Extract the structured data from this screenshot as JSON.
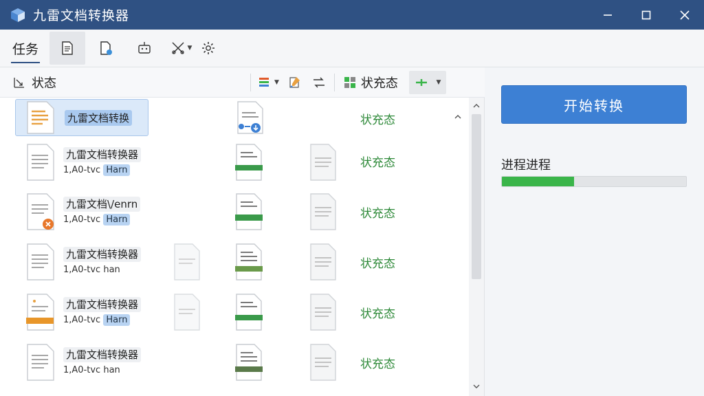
{
  "window": {
    "title": "九雷文档转换器",
    "controls": [
      "minimize-icon",
      "maximize-icon",
      "close-icon"
    ]
  },
  "toolbar": {
    "task_tab": "任务",
    "icons": [
      "document-icon",
      "file-settings-icon",
      "robot-icon",
      "tools-icon",
      "gear-icon"
    ]
  },
  "sub_toolbar": {
    "label": "状态",
    "status_label": "状充态"
  },
  "rows": [
    {
      "name": "九雷文档转换",
      "meta_prefix": "",
      "tag": "",
      "status": "状充态",
      "selected": true
    },
    {
      "name": "九雷文档转换器",
      "meta_prefix": "1,A0-tvc",
      "tag": "Harn",
      "status": "状充态",
      "selected": false
    },
    {
      "name": "九雷文档\\/enrn",
      "meta_prefix": "1,A0-tvc",
      "tag": "Harn",
      "status": "状充态",
      "selected": false
    },
    {
      "name": "九雷文档转换器",
      "meta_prefix": "1,A0-tvc han",
      "tag": "",
      "status": "状充态",
      "selected": false
    },
    {
      "name": "九雷文档转换器",
      "meta_prefix": "1,A0-tvc",
      "tag": "Harn",
      "status": "状充态",
      "selected": false
    },
    {
      "name": "九雷文档转换器",
      "meta_prefix": "1,A0-tvc han",
      "tag": "",
      "status": "状充态",
      "selected": false
    }
  ],
  "right_panel": {
    "start_button": "开始转换",
    "progress_label": "进程进程",
    "progress_fraction": 0.39
  },
  "colors": {
    "titlebar": "#2f5183",
    "accent": "#3d80d4",
    "status_green": "#2f8a3a",
    "progress_green": "#3ab54a"
  }
}
